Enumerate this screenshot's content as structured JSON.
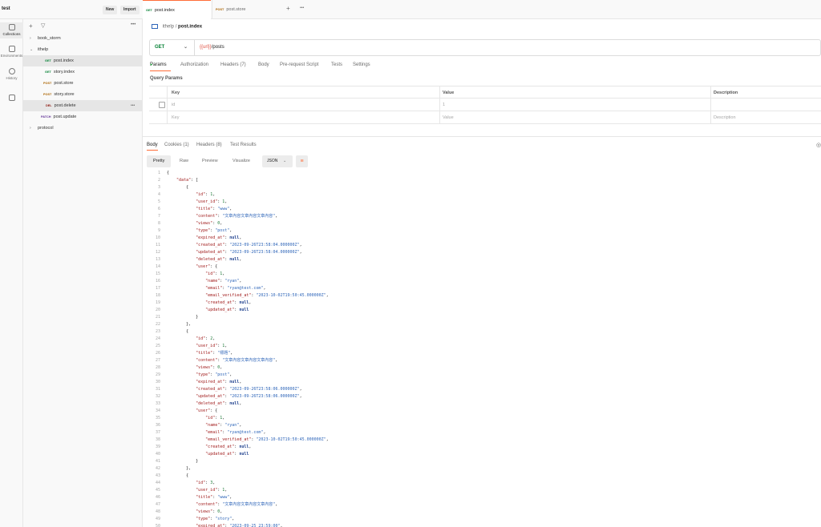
{
  "workspace": {
    "name": "test",
    "new_label": "New",
    "import_label": "Import"
  },
  "rail": [
    {
      "label": "Collections",
      "icon": "trash-can-icon"
    },
    {
      "label": "Environments",
      "icon": "environment-icon"
    },
    {
      "label": "History",
      "icon": "history-icon"
    },
    {
      "label": "",
      "icon": "grid-icon"
    }
  ],
  "sidebar": {
    "items": [
      {
        "label": "book_storm",
        "chevron": ">"
      },
      {
        "label": "ithelp",
        "chevron": "v"
      },
      {
        "method": "GET",
        "label": "post.index"
      },
      {
        "method": "GET",
        "label": "story.index"
      },
      {
        "method": "POST",
        "label": "post.store"
      },
      {
        "method": "POST",
        "label": "story.store"
      },
      {
        "method": "DEL",
        "label": "post.delete"
      },
      {
        "method": "PATCH",
        "label": "post.update"
      },
      {
        "label": "protocol",
        "chevron": ">"
      }
    ]
  },
  "tabs": [
    {
      "method": "GET",
      "label": "post.index"
    },
    {
      "method": "POST",
      "label": "post.store"
    }
  ],
  "breadcrumb": {
    "parent": "ithelp",
    "sep": "/",
    "current": "post.index"
  },
  "request": {
    "method": "GET",
    "url_var": "{{url}}",
    "url_path": "/posts",
    "tabs": [
      "Params",
      "Authorization",
      "Headers (7)",
      "Body",
      "Pre-request Script",
      "Tests",
      "Settings"
    ],
    "query_params_title": "Query Params",
    "columns": [
      "Key",
      "Value",
      "Description"
    ],
    "rows": [
      {
        "key": "id",
        "value": "1",
        "description": ""
      },
      {
        "key": "Key",
        "value": "Value",
        "description": "Description"
      }
    ]
  },
  "response": {
    "tabs": [
      "Body",
      "Cookies (1)",
      "Headers (8)",
      "Test Results"
    ],
    "views": [
      "Pretty",
      "Raw",
      "Preview",
      "Visualize"
    ],
    "format": "JSON"
  },
  "code_lines": [
    [
      {
        "t": "{",
        "c": "p"
      }
    ],
    [
      {
        "t": "    ",
        "c": "p"
      },
      {
        "t": "\"data\"",
        "c": "k"
      },
      {
        "t": ": [",
        "c": "p"
      }
    ],
    [
      {
        "t": "        {",
        "c": "p"
      }
    ],
    [
      {
        "t": "            ",
        "c": "p"
      },
      {
        "t": "\"id\"",
        "c": "k"
      },
      {
        "t": ": ",
        "c": "p"
      },
      {
        "t": "1",
        "c": "n"
      },
      {
        "t": ",",
        "c": "p"
      }
    ],
    [
      {
        "t": "            ",
        "c": "p"
      },
      {
        "t": "\"user_id\"",
        "c": "k"
      },
      {
        "t": ": ",
        "c": "p"
      },
      {
        "t": "1",
        "c": "n"
      },
      {
        "t": ",",
        "c": "p"
      }
    ],
    [
      {
        "t": "            ",
        "c": "p"
      },
      {
        "t": "\"title\"",
        "c": "k"
      },
      {
        "t": ": ",
        "c": "p"
      },
      {
        "t": "\"www\"",
        "c": "s"
      },
      {
        "t": ",",
        "c": "p"
      }
    ],
    [
      {
        "t": "            ",
        "c": "p"
      },
      {
        "t": "\"content\"",
        "c": "k"
      },
      {
        "t": ": ",
        "c": "p"
      },
      {
        "t": "\"文章內容文章內容文章內容\"",
        "c": "s"
      },
      {
        "t": ",",
        "c": "p"
      }
    ],
    [
      {
        "t": "            ",
        "c": "p"
      },
      {
        "t": "\"views\"",
        "c": "k"
      },
      {
        "t": ": ",
        "c": "p"
      },
      {
        "t": "0",
        "c": "n"
      },
      {
        "t": ",",
        "c": "p"
      }
    ],
    [
      {
        "t": "            ",
        "c": "p"
      },
      {
        "t": "\"type\"",
        "c": "k"
      },
      {
        "t": ": ",
        "c": "p"
      },
      {
        "t": "\"post\"",
        "c": "s"
      },
      {
        "t": ",",
        "c": "p"
      }
    ],
    [
      {
        "t": "            ",
        "c": "p"
      },
      {
        "t": "\"expired_at\"",
        "c": "k"
      },
      {
        "t": ": ",
        "c": "p"
      },
      {
        "t": "null",
        "c": "nl"
      },
      {
        "t": ",",
        "c": "p"
      }
    ],
    [
      {
        "t": "            ",
        "c": "p"
      },
      {
        "t": "\"created_at\"",
        "c": "k"
      },
      {
        "t": ": ",
        "c": "p"
      },
      {
        "t": "\"2023-09-26T23:58:04.000000Z\"",
        "c": "s"
      },
      {
        "t": ",",
        "c": "p"
      }
    ],
    [
      {
        "t": "            ",
        "c": "p"
      },
      {
        "t": "\"updated_at\"",
        "c": "k"
      },
      {
        "t": ": ",
        "c": "p"
      },
      {
        "t": "\"2023-09-26T23:58:04.000000Z\"",
        "c": "s"
      },
      {
        "t": ",",
        "c": "p"
      }
    ],
    [
      {
        "t": "            ",
        "c": "p"
      },
      {
        "t": "\"deleted_at\"",
        "c": "k"
      },
      {
        "t": ": ",
        "c": "p"
      },
      {
        "t": "null",
        "c": "nl"
      },
      {
        "t": ",",
        "c": "p"
      }
    ],
    [
      {
        "t": "            ",
        "c": "p"
      },
      {
        "t": "\"user\"",
        "c": "k"
      },
      {
        "t": ": {",
        "c": "p"
      }
    ],
    [
      {
        "t": "                ",
        "c": "p"
      },
      {
        "t": "\"id\"",
        "c": "k"
      },
      {
        "t": ": ",
        "c": "p"
      },
      {
        "t": "1",
        "c": "n"
      },
      {
        "t": ",",
        "c": "p"
      }
    ],
    [
      {
        "t": "                ",
        "c": "p"
      },
      {
        "t": "\"name\"",
        "c": "k"
      },
      {
        "t": ": ",
        "c": "p"
      },
      {
        "t": "\"ryan\"",
        "c": "s"
      },
      {
        "t": ",",
        "c": "p"
      }
    ],
    [
      {
        "t": "                ",
        "c": "p"
      },
      {
        "t": "\"email\"",
        "c": "k"
      },
      {
        "t": ": ",
        "c": "p"
      },
      {
        "t": "\"ryan@test.com\"",
        "c": "s"
      },
      {
        "t": ",",
        "c": "p"
      }
    ],
    [
      {
        "t": "                ",
        "c": "p"
      },
      {
        "t": "\"email_verified_at\"",
        "c": "k"
      },
      {
        "t": ": ",
        "c": "p"
      },
      {
        "t": "\"2023-10-02T19:50:45.000000Z\"",
        "c": "s"
      },
      {
        "t": ",",
        "c": "p"
      }
    ],
    [
      {
        "t": "                ",
        "c": "p"
      },
      {
        "t": "\"created_at\"",
        "c": "k"
      },
      {
        "t": ": ",
        "c": "p"
      },
      {
        "t": "null",
        "c": "nl"
      },
      {
        "t": ",",
        "c": "p"
      }
    ],
    [
      {
        "t": "                ",
        "c": "p"
      },
      {
        "t": "\"updated_at\"",
        "c": "k"
      },
      {
        "t": ": ",
        "c": "p"
      },
      {
        "t": "null",
        "c": "nl"
      }
    ],
    [
      {
        "t": "            }",
        "c": "p"
      }
    ],
    [
      {
        "t": "        },",
        "c": "p"
      }
    ],
    [
      {
        "t": "        {",
        "c": "p"
      }
    ],
    [
      {
        "t": "            ",
        "c": "p"
      },
      {
        "t": "\"id\"",
        "c": "k"
      },
      {
        "t": ": ",
        "c": "p"
      },
      {
        "t": "2",
        "c": "n"
      },
      {
        "t": ",",
        "c": "p"
      }
    ],
    [
      {
        "t": "            ",
        "c": "p"
      },
      {
        "t": "\"user_id\"",
        "c": "k"
      },
      {
        "t": ": ",
        "c": "p"
      },
      {
        "t": "1",
        "c": "n"
      },
      {
        "t": ",",
        "c": "p"
      }
    ],
    [
      {
        "t": "            ",
        "c": "p"
      },
      {
        "t": "\"title\"",
        "c": "k"
      },
      {
        "t": ": ",
        "c": "p"
      },
      {
        "t": "\"標題\"",
        "c": "s"
      },
      {
        "t": ",",
        "c": "p"
      }
    ],
    [
      {
        "t": "            ",
        "c": "p"
      },
      {
        "t": "\"content\"",
        "c": "k"
      },
      {
        "t": ": ",
        "c": "p"
      },
      {
        "t": "\"文章內容文章內容文章內容\"",
        "c": "s"
      },
      {
        "t": ",",
        "c": "p"
      }
    ],
    [
      {
        "t": "            ",
        "c": "p"
      },
      {
        "t": "\"views\"",
        "c": "k"
      },
      {
        "t": ": ",
        "c": "p"
      },
      {
        "t": "0",
        "c": "n"
      },
      {
        "t": ",",
        "c": "p"
      }
    ],
    [
      {
        "t": "            ",
        "c": "p"
      },
      {
        "t": "\"type\"",
        "c": "k"
      },
      {
        "t": ": ",
        "c": "p"
      },
      {
        "t": "\"post\"",
        "c": "s"
      },
      {
        "t": ",",
        "c": "p"
      }
    ],
    [
      {
        "t": "            ",
        "c": "p"
      },
      {
        "t": "\"expired_at\"",
        "c": "k"
      },
      {
        "t": ": ",
        "c": "p"
      },
      {
        "t": "null",
        "c": "nl"
      },
      {
        "t": ",",
        "c": "p"
      }
    ],
    [
      {
        "t": "            ",
        "c": "p"
      },
      {
        "t": "\"created_at\"",
        "c": "k"
      },
      {
        "t": ": ",
        "c": "p"
      },
      {
        "t": "\"2023-09-26T23:58:06.000000Z\"",
        "c": "s"
      },
      {
        "t": ",",
        "c": "p"
      }
    ],
    [
      {
        "t": "            ",
        "c": "p"
      },
      {
        "t": "\"updated_at\"",
        "c": "k"
      },
      {
        "t": ": ",
        "c": "p"
      },
      {
        "t": "\"2023-09-26T23:58:06.000000Z\"",
        "c": "s"
      },
      {
        "t": ",",
        "c": "p"
      }
    ],
    [
      {
        "t": "            ",
        "c": "p"
      },
      {
        "t": "\"deleted_at\"",
        "c": "k"
      },
      {
        "t": ": ",
        "c": "p"
      },
      {
        "t": "null",
        "c": "nl"
      },
      {
        "t": ",",
        "c": "p"
      }
    ],
    [
      {
        "t": "            ",
        "c": "p"
      },
      {
        "t": "\"user\"",
        "c": "k"
      },
      {
        "t": ": {",
        "c": "p"
      }
    ],
    [
      {
        "t": "                ",
        "c": "p"
      },
      {
        "t": "\"id\"",
        "c": "k"
      },
      {
        "t": ": ",
        "c": "p"
      },
      {
        "t": "1",
        "c": "n"
      },
      {
        "t": ",",
        "c": "p"
      }
    ],
    [
      {
        "t": "                ",
        "c": "p"
      },
      {
        "t": "\"name\"",
        "c": "k"
      },
      {
        "t": ": ",
        "c": "p"
      },
      {
        "t": "\"ryan\"",
        "c": "s"
      },
      {
        "t": ",",
        "c": "p"
      }
    ],
    [
      {
        "t": "                ",
        "c": "p"
      },
      {
        "t": "\"email\"",
        "c": "k"
      },
      {
        "t": ": ",
        "c": "p"
      },
      {
        "t": "\"ryan@test.com\"",
        "c": "s"
      },
      {
        "t": ",",
        "c": "p"
      }
    ],
    [
      {
        "t": "                ",
        "c": "p"
      },
      {
        "t": "\"email_verified_at\"",
        "c": "k"
      },
      {
        "t": ": ",
        "c": "p"
      },
      {
        "t": "\"2023-10-02T19:50:45.000000Z\"",
        "c": "s"
      },
      {
        "t": ",",
        "c": "p"
      }
    ],
    [
      {
        "t": "                ",
        "c": "p"
      },
      {
        "t": "\"created_at\"",
        "c": "k"
      },
      {
        "t": ": ",
        "c": "p"
      },
      {
        "t": "null",
        "c": "nl"
      },
      {
        "t": ",",
        "c": "p"
      }
    ],
    [
      {
        "t": "                ",
        "c": "p"
      },
      {
        "t": "\"updated_at\"",
        "c": "k"
      },
      {
        "t": ": ",
        "c": "p"
      },
      {
        "t": "null",
        "c": "nl"
      }
    ],
    [
      {
        "t": "            }",
        "c": "p"
      }
    ],
    [
      {
        "t": "        },",
        "c": "p"
      }
    ],
    [
      {
        "t": "        {",
        "c": "p"
      }
    ],
    [
      {
        "t": "            ",
        "c": "p"
      },
      {
        "t": "\"id\"",
        "c": "k"
      },
      {
        "t": ": ",
        "c": "p"
      },
      {
        "t": "3",
        "c": "n"
      },
      {
        "t": ",",
        "c": "p"
      }
    ],
    [
      {
        "t": "            ",
        "c": "p"
      },
      {
        "t": "\"user_id\"",
        "c": "k"
      },
      {
        "t": ": ",
        "c": "p"
      },
      {
        "t": "1",
        "c": "n"
      },
      {
        "t": ",",
        "c": "p"
      }
    ],
    [
      {
        "t": "            ",
        "c": "p"
      },
      {
        "t": "\"title\"",
        "c": "k"
      },
      {
        "t": ": ",
        "c": "p"
      },
      {
        "t": "\"www\"",
        "c": "s"
      },
      {
        "t": ",",
        "c": "p"
      }
    ],
    [
      {
        "t": "            ",
        "c": "p"
      },
      {
        "t": "\"content\"",
        "c": "k"
      },
      {
        "t": ": ",
        "c": "p"
      },
      {
        "t": "\"文章內容文章內容文章內容\"",
        "c": "s"
      },
      {
        "t": ",",
        "c": "p"
      }
    ],
    [
      {
        "t": "            ",
        "c": "p"
      },
      {
        "t": "\"views\"",
        "c": "k"
      },
      {
        "t": ": ",
        "c": "p"
      },
      {
        "t": "0",
        "c": "n"
      },
      {
        "t": ",",
        "c": "p"
      }
    ],
    [
      {
        "t": "            ",
        "c": "p"
      },
      {
        "t": "\"type\"",
        "c": "k"
      },
      {
        "t": ": ",
        "c": "p"
      },
      {
        "t": "\"story\"",
        "c": "s"
      },
      {
        "t": ",",
        "c": "p"
      }
    ],
    [
      {
        "t": "            ",
        "c": "p"
      },
      {
        "t": "\"expired_at\"",
        "c": "k"
      },
      {
        "t": ": ",
        "c": "p"
      },
      {
        "t": "\"2023-09-25 23:59:00\"",
        "c": "s"
      },
      {
        "t": ",",
        "c": "p"
      }
    ]
  ],
  "colors": {
    "accent": "#ff6c37",
    "get": "#007f31",
    "post": "#ab6400",
    "delete": "#8e1a10",
    "patch": "#623497"
  }
}
